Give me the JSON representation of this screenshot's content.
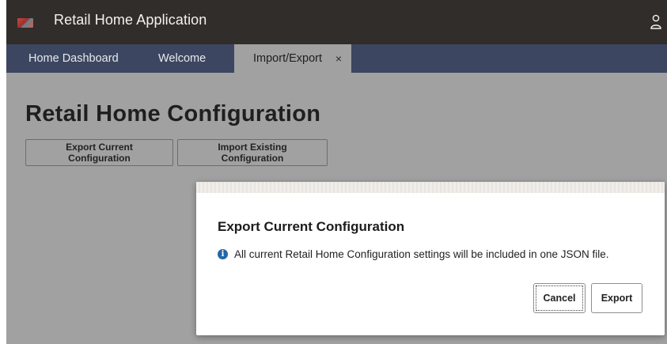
{
  "app": {
    "title": "Retail Home Application"
  },
  "tabs": [
    {
      "label": "Home Dashboard"
    },
    {
      "label": "Welcome"
    },
    {
      "label": "Import/Export",
      "close": "×",
      "active": true
    }
  ],
  "page": {
    "title": "Retail Home Configuration",
    "export_button": "Export Current Configuration",
    "import_button": "Import Existing Configuration"
  },
  "dialog": {
    "title": "Export Current Configuration",
    "info_icon_glyph": "i",
    "message": "All current Retail Home Configuration settings will be included in one JSON file.",
    "cancel_label": "Cancel",
    "export_label": "Export"
  },
  "icons": {
    "logo": "app-logo-icon",
    "user": "user-icon",
    "info": "info-icon",
    "close": "close-icon"
  },
  "colors": {
    "header_bg": "#302d2a",
    "tabbar_bg": "#3c4660",
    "overlay_bg": "#a1a1a1",
    "info_blue": "#2366a8"
  }
}
